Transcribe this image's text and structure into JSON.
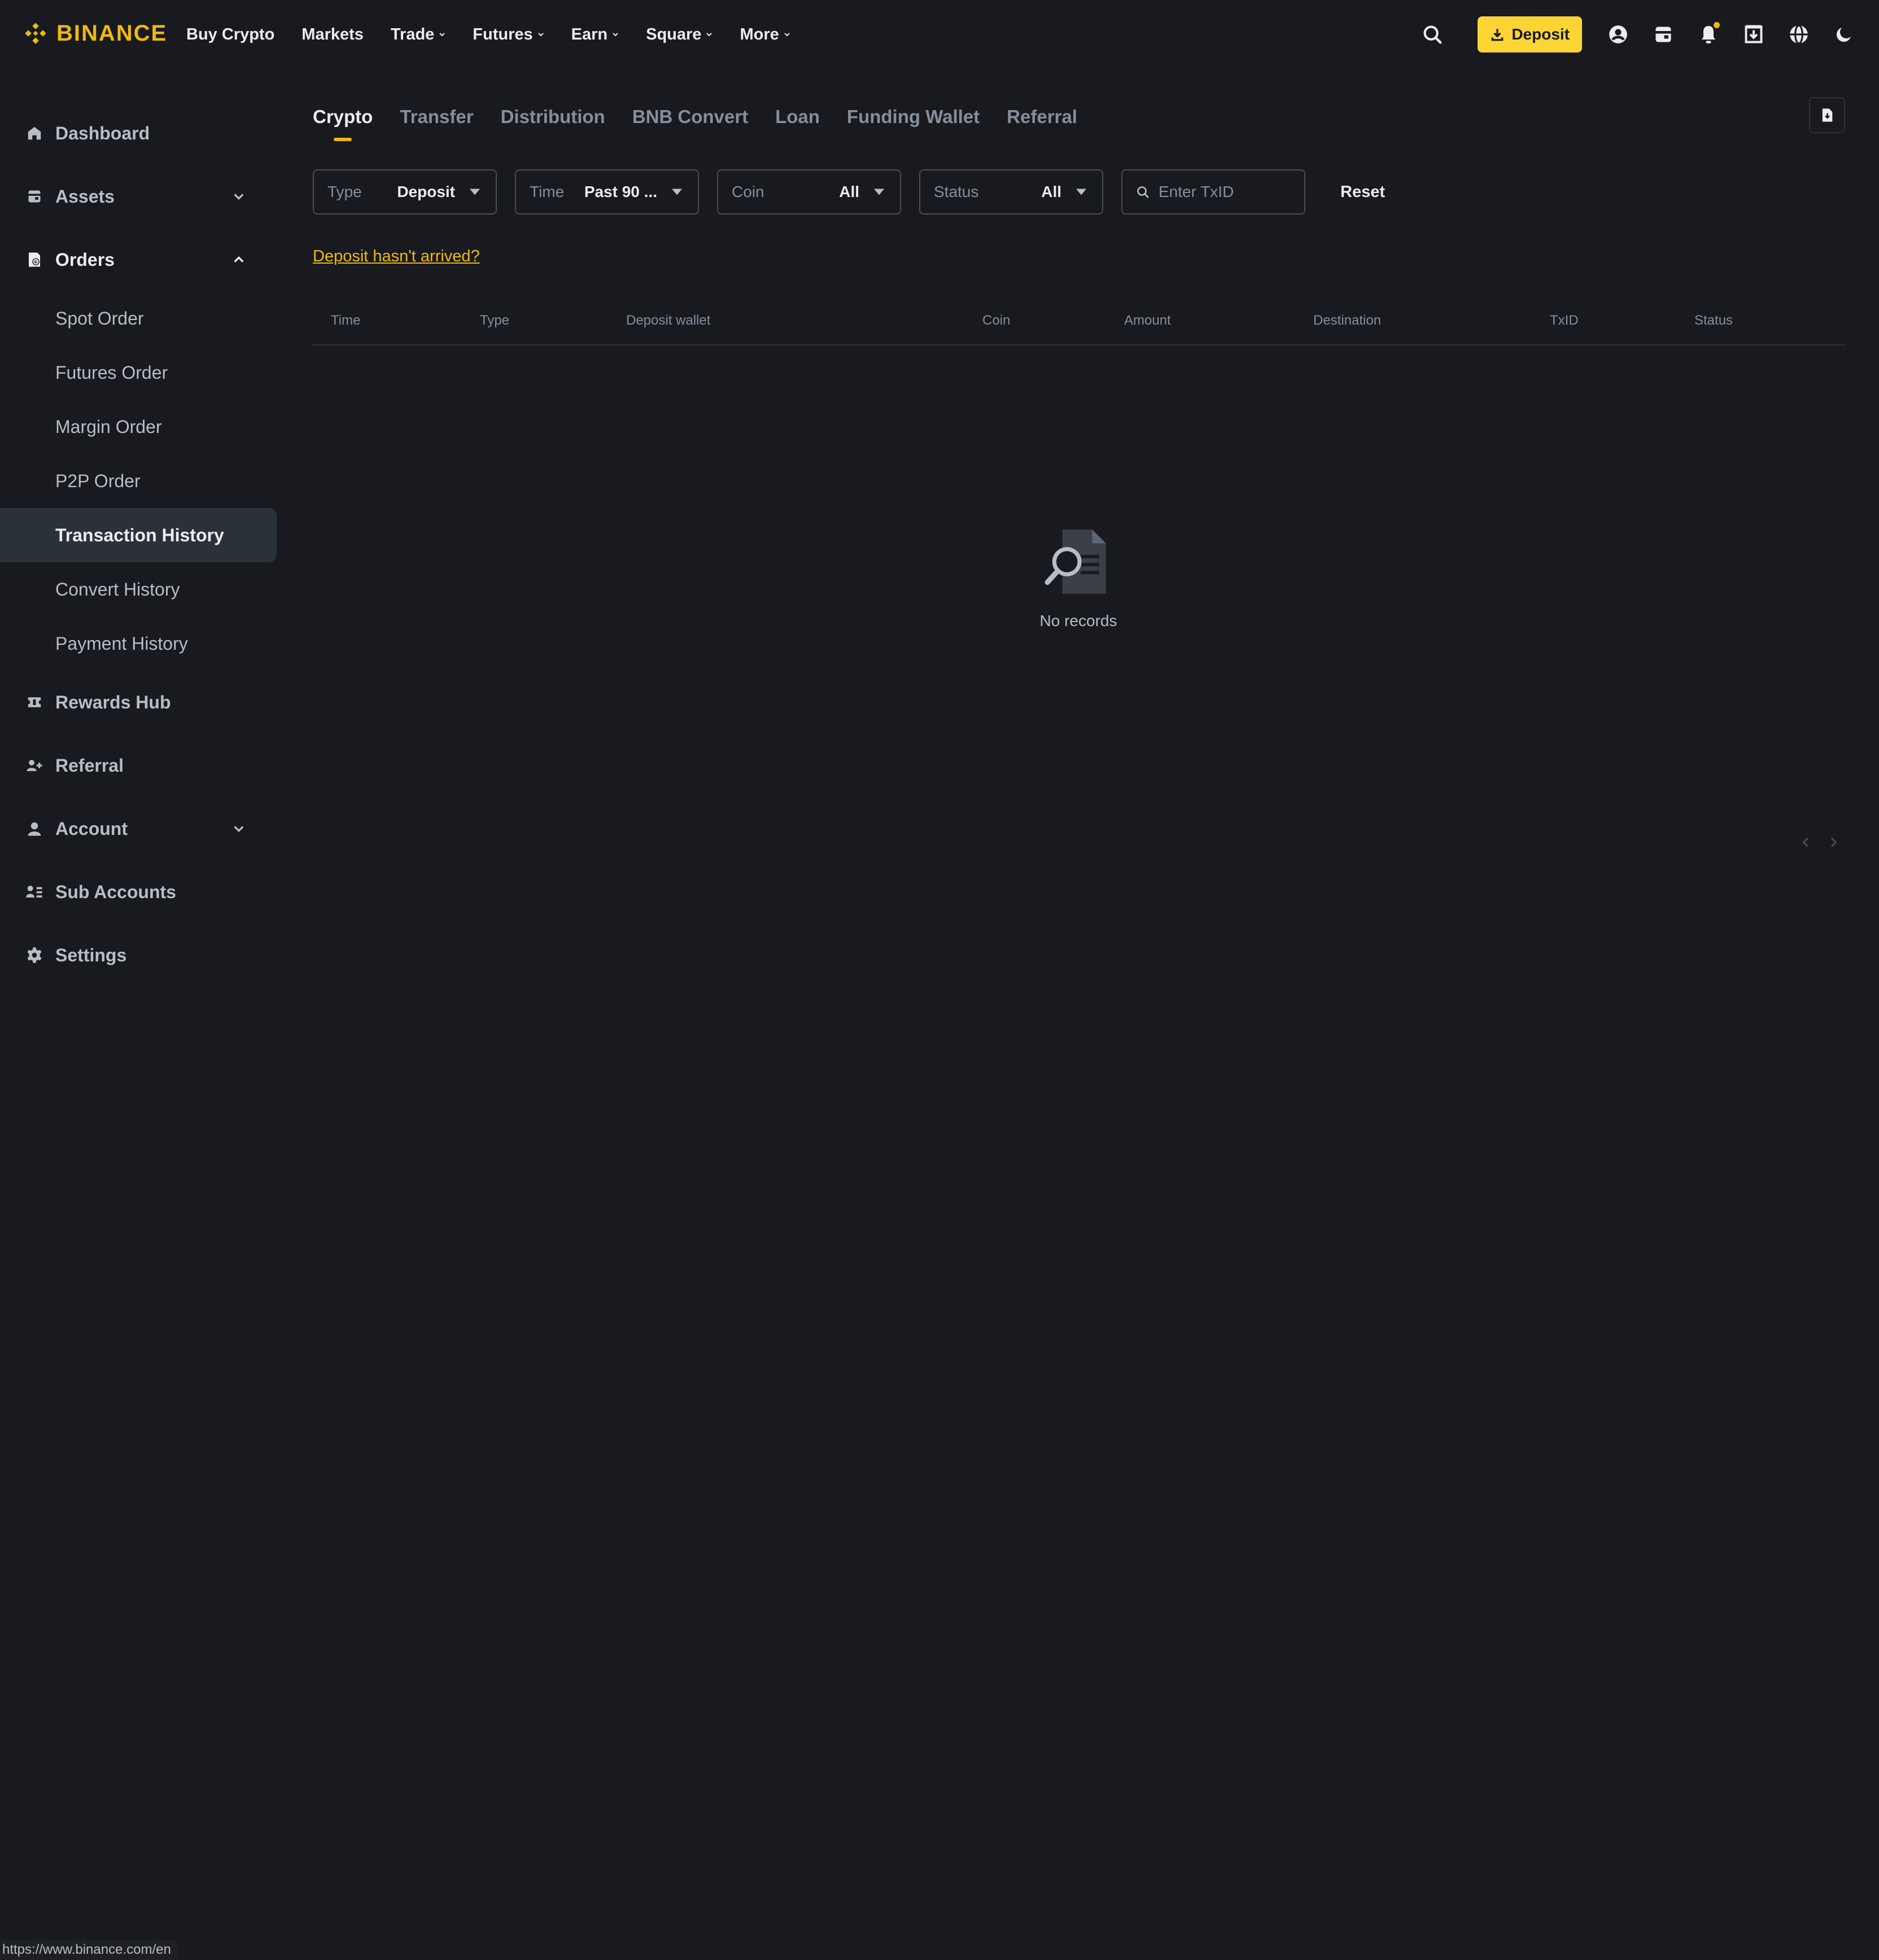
{
  "brand": {
    "name": "BINANCE",
    "color": "#f0b90b"
  },
  "nav": [
    {
      "label": "Buy Crypto",
      "dropdown": false
    },
    {
      "label": "Markets",
      "dropdown": false
    },
    {
      "label": "Trade",
      "dropdown": true
    },
    {
      "label": "Futures",
      "dropdown": true
    },
    {
      "label": "Earn",
      "dropdown": true
    },
    {
      "label": "Square",
      "dropdown": true
    },
    {
      "label": "More",
      "dropdown": true
    }
  ],
  "header": {
    "deposit_label": "Deposit",
    "icons": [
      "search-icon",
      "user-icon",
      "wallet-icon",
      "bell-icon",
      "download-app-icon",
      "globe-icon",
      "moon-icon"
    ]
  },
  "sidebar": {
    "items": [
      {
        "label": "Dashboard",
        "icon": "home-icon"
      },
      {
        "label": "Assets",
        "icon": "wallet-icon",
        "expand": "down"
      },
      {
        "label": "Orders",
        "icon": "orders-icon",
        "expand": "up"
      },
      {
        "label": "Rewards Hub",
        "icon": "ticket-icon"
      },
      {
        "label": "Referral",
        "icon": "add-user-icon"
      },
      {
        "label": "Account",
        "icon": "person-icon",
        "expand": "down"
      },
      {
        "label": "Sub Accounts",
        "icon": "sub-accounts-icon"
      },
      {
        "label": "Settings",
        "icon": "gear-icon"
      }
    ],
    "orders_sub": [
      {
        "label": "Spot Order",
        "active": false
      },
      {
        "label": "Futures Order",
        "active": false
      },
      {
        "label": "Margin Order",
        "active": false
      },
      {
        "label": "P2P Order",
        "active": false
      },
      {
        "label": "Transaction History",
        "active": true
      },
      {
        "label": "Convert History",
        "active": false
      },
      {
        "label": "Payment History",
        "active": false
      }
    ]
  },
  "tabs": [
    {
      "label": "Crypto",
      "active": true
    },
    {
      "label": "Transfer",
      "active": false
    },
    {
      "label": "Distribution",
      "active": false
    },
    {
      "label": "BNB Convert",
      "active": false
    },
    {
      "label": "Loan",
      "active": false
    },
    {
      "label": "Funding Wallet",
      "active": false
    },
    {
      "label": "Referral",
      "active": false
    }
  ],
  "filters": {
    "type": {
      "label": "Type",
      "value": "Deposit"
    },
    "time": {
      "label": "Time",
      "value": "Past 90 ..."
    },
    "coin": {
      "label": "Coin",
      "value": "All"
    },
    "status": {
      "label": "Status",
      "value": "All"
    },
    "txid_placeholder": "Enter TxID",
    "reset_label": "Reset"
  },
  "help_link": "Deposit hasn't arrived?",
  "table": {
    "columns": [
      "Time",
      "Type",
      "Deposit wallet",
      "Coin",
      "Amount",
      "Destination",
      "TxID",
      "Status"
    ],
    "rows": [],
    "empty_text": "No records"
  },
  "statusbar_url": "https://www.binance.com/en"
}
